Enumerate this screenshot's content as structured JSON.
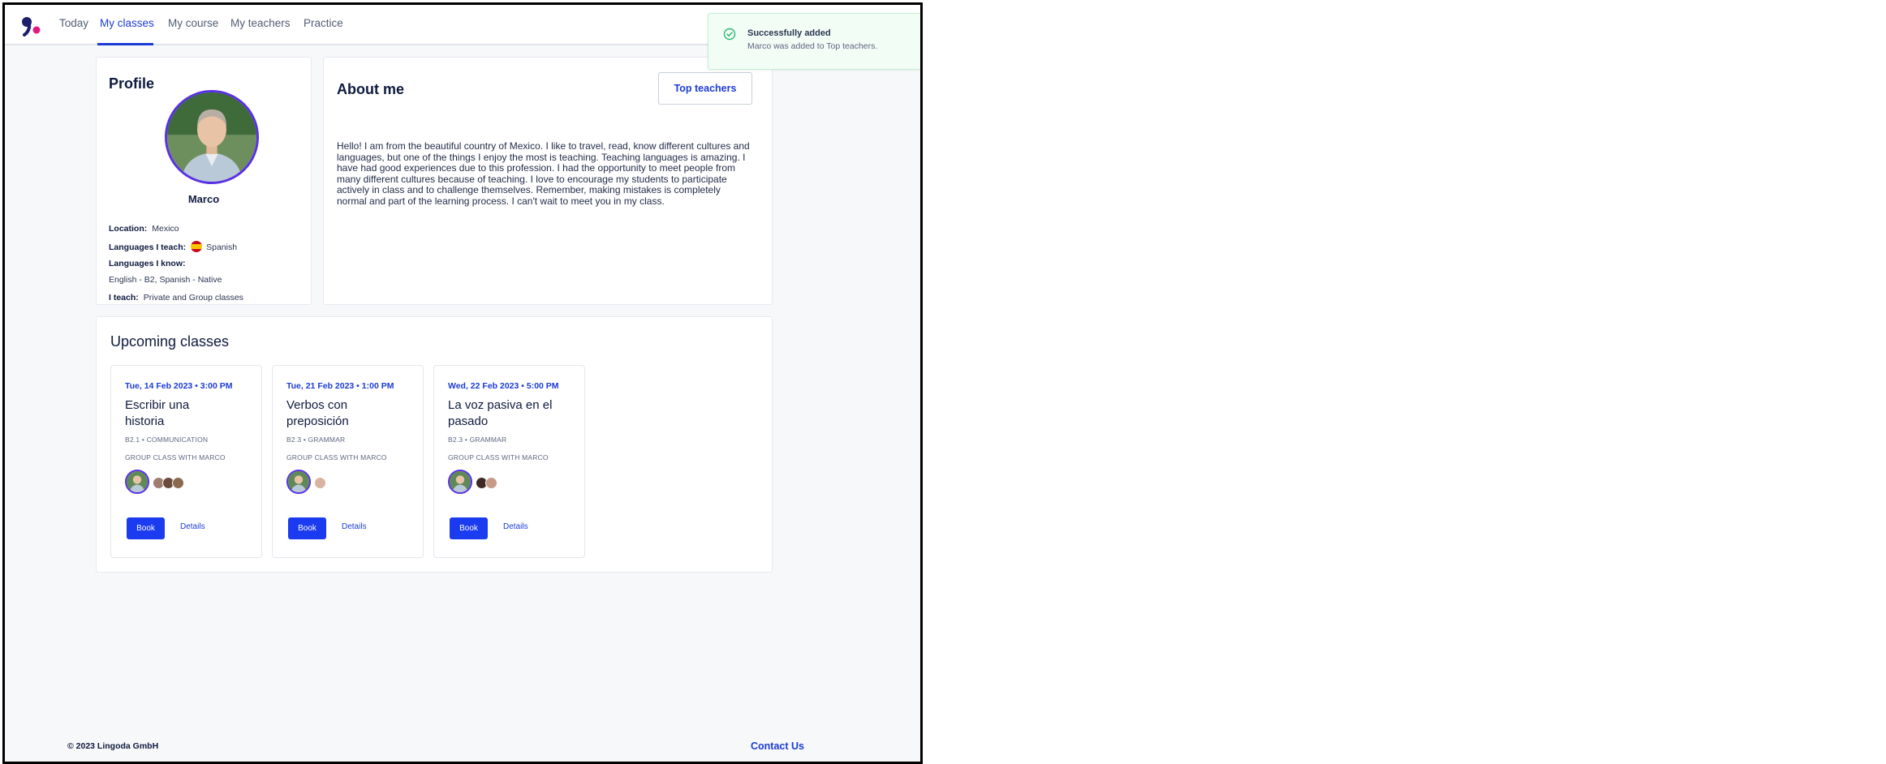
{
  "nav": {
    "items": [
      {
        "label": "Today"
      },
      {
        "label": "My classes"
      },
      {
        "label": "My course"
      },
      {
        "label": "My teachers"
      },
      {
        "label": "Practice"
      }
    ],
    "active_index": 1
  },
  "profile": {
    "heading": "Profile",
    "name": "Marco",
    "location_label": "Location:",
    "location": "Mexico",
    "teaches_label": "Languages I teach:",
    "teaches": "Spanish",
    "knows_label": "Languages I know:",
    "knows": "English - B2, Spanish - Native",
    "iteach_label": "I teach:",
    "iteach": "Private and Group classes"
  },
  "about": {
    "heading": "About me",
    "button_label": "Top teachers",
    "text": "Hello! I am from the beautiful country of Mexico. I like to travel, read, know different cultures and languages, but one of the things I enjoy the most is teaching. Teaching languages is amazing. I have had good experiences due to this profession. I had the opportunity to meet people from many different cultures because of teaching. I love to encourage my students to participate actively in class and to challenge themselves. Remember, making mistakes is completely normal and part of the learning process. I can't wait to meet you in my class."
  },
  "upcoming": {
    "heading": "Upcoming classes",
    "classes": [
      {
        "date": "Tue, 14 Feb 2023 • 3:00 PM",
        "title": "Escribir una historia",
        "level": "B2.1 •",
        "category": "COMMUNICATION",
        "host": "GROUP CLASS WITH MARCO",
        "book_label": "Book",
        "details_label": "Details"
      },
      {
        "date": "Tue, 21 Feb 2023 • 1:00 PM",
        "title": "Verbos con preposición",
        "level": "B2.3 •",
        "category": "GRAMMAR",
        "host": "GROUP CLASS WITH MARCO",
        "book_label": "Book",
        "details_label": "Details"
      },
      {
        "date": "Wed, 22 Feb 2023 • 5:00 PM",
        "title": "La voz pasiva en el pasado",
        "level": "B2.3 •",
        "category": "GRAMMAR",
        "host": "GROUP CLASS WITH MARCO",
        "book_label": "Book",
        "details_label": "Details"
      }
    ]
  },
  "footer": {
    "copyright": "© 2023 Lingoda GmbH",
    "contact": "Contact Us"
  },
  "toast": {
    "title": "Successfully added",
    "message": "Marco was added to Top teachers."
  },
  "colors": {
    "accent": "#1b3bd6",
    "book_button": "#1b3bf0",
    "avatar_ring": "#5a30e6",
    "toast_bg": "#f1fdf5",
    "toast_icon": "#2eb872"
  }
}
